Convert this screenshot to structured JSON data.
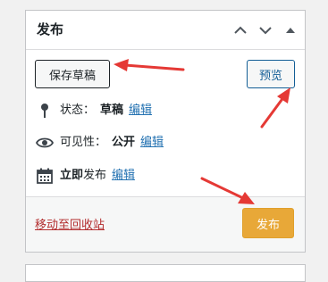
{
  "panel": {
    "title": "发布",
    "header_buttons": [
      {
        "icon": "chevron-up-icon"
      },
      {
        "icon": "chevron-down-icon"
      },
      {
        "icon": "triangle-up-icon"
      }
    ],
    "save_draft_label": "保存草稿",
    "preview_label": "预览",
    "status": {
      "icon": "pin-icon",
      "label": "状态：",
      "value": "草稿",
      "edit_label": "编辑"
    },
    "visibility": {
      "icon": "eye-icon",
      "label": "可见性：",
      "value": "公开",
      "edit_label": "编辑"
    },
    "schedule": {
      "icon": "calendar-icon",
      "value": "立即",
      "label": "发布",
      "edit_label": "编辑"
    },
    "trash_label": "移动至回收站",
    "publish_label": "发布"
  },
  "colors": {
    "publish_button": "#e8a838",
    "link": "#2271b1",
    "trash_link": "#b32d2e",
    "annotation_arrow": "#e53935"
  }
}
